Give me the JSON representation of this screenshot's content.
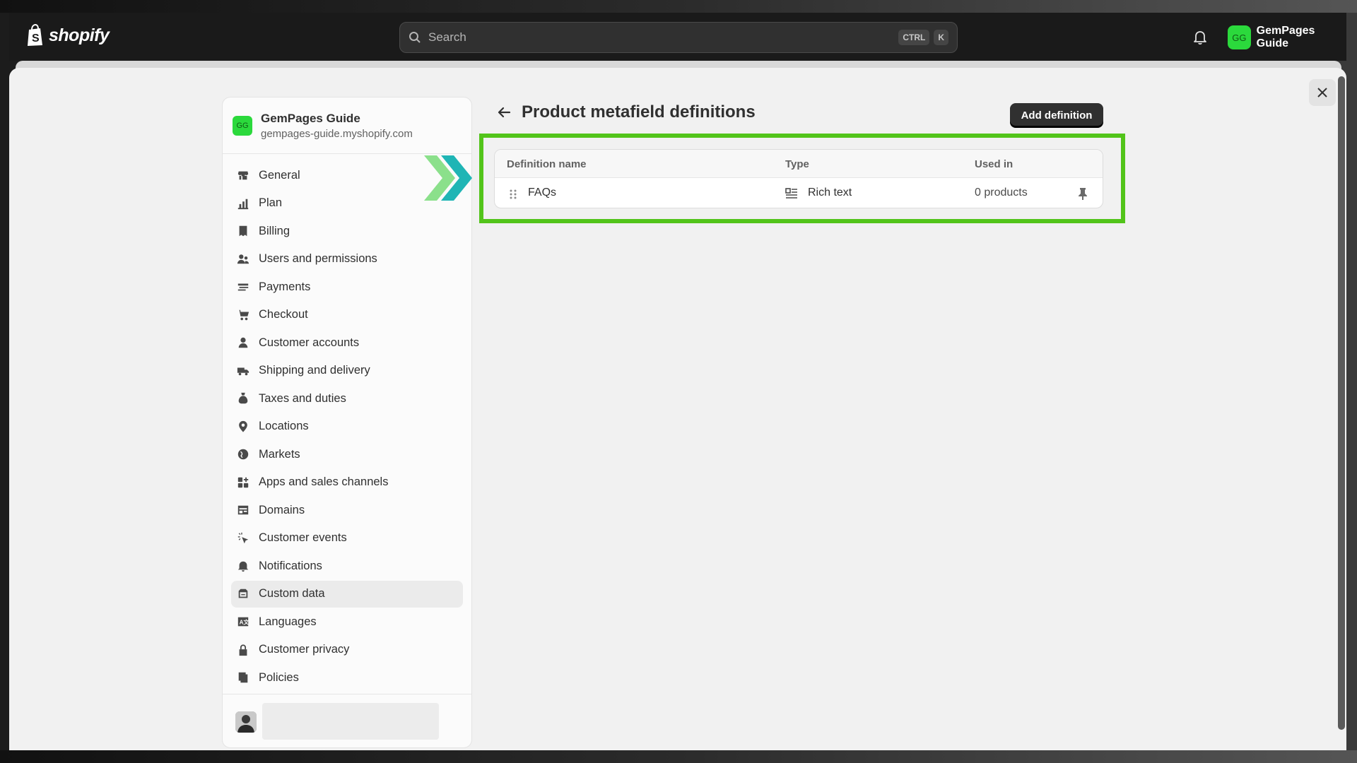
{
  "topbar": {
    "brand": "shopify",
    "search_placeholder": "Search",
    "shortcut_ctrl": "CTRL",
    "shortcut_k": "K",
    "store_initials": "GG",
    "store_name": "GemPages Guide"
  },
  "sidebar": {
    "store_initials": "GG",
    "store_name": "GemPages Guide",
    "store_url": "gempages-guide.myshopify.com",
    "items": [
      {
        "label": "General",
        "icon": "store-icon"
      },
      {
        "label": "Plan",
        "icon": "plan-icon"
      },
      {
        "label": "Billing",
        "icon": "billing-icon"
      },
      {
        "label": "Users and permissions",
        "icon": "users-icon"
      },
      {
        "label": "Payments",
        "icon": "payments-icon"
      },
      {
        "label": "Checkout",
        "icon": "cart-icon"
      },
      {
        "label": "Customer accounts",
        "icon": "person-icon"
      },
      {
        "label": "Shipping and delivery",
        "icon": "truck-icon"
      },
      {
        "label": "Taxes and duties",
        "icon": "tax-icon"
      },
      {
        "label": "Locations",
        "icon": "location-icon"
      },
      {
        "label": "Markets",
        "icon": "globe-icon"
      },
      {
        "label": "Apps and sales channels",
        "icon": "apps-icon"
      },
      {
        "label": "Domains",
        "icon": "domains-icon"
      },
      {
        "label": "Customer events",
        "icon": "cursor-click-icon"
      },
      {
        "label": "Notifications",
        "icon": "bell-icon"
      },
      {
        "label": "Custom data",
        "icon": "database-icon",
        "active": true
      },
      {
        "label": "Languages",
        "icon": "language-icon"
      },
      {
        "label": "Customer privacy",
        "icon": "lock-icon"
      },
      {
        "label": "Policies",
        "icon": "policies-icon"
      }
    ]
  },
  "main": {
    "title": "Product metafield definitions",
    "add_button": "Add definition",
    "columns": [
      "Definition name",
      "Type",
      "Used in"
    ],
    "rows": [
      {
        "name": "FAQs",
        "type": "Rich text",
        "used_in": "0 products"
      }
    ]
  },
  "colors": {
    "highlight": "#52c41a",
    "store_badge": "#2bd93c",
    "arrow_light": "#8be08b",
    "arrow_dark": "#1fb5b5"
  }
}
